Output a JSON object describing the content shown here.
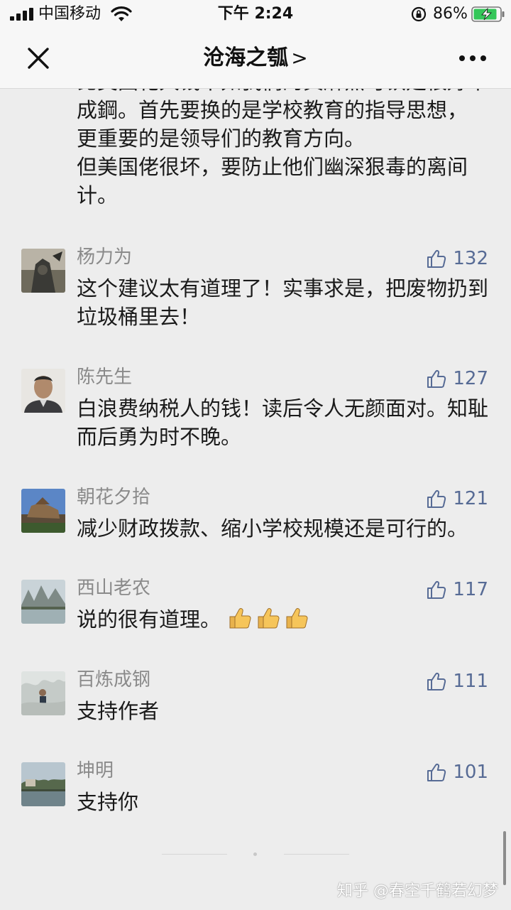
{
  "status_bar": {
    "carrier": "中国移动",
    "time": "下午 2:24",
    "battery_pct": "86%"
  },
  "nav": {
    "title": "沧海之瓠",
    "title_chevron": ">",
    "close_icon": "close-icon",
    "more_icon": "more-icon"
  },
  "article_tail": {
    "lines": [
      "成鋼。首先要换的是学校教育的指导思想，",
      "更重要的是领导们的教育方向。",
      "但美国佬很坏，要防止他们幽深狠毒的离间",
      "计。"
    ]
  },
  "comments": [
    {
      "name": "杨力为",
      "likes": "132",
      "text": "这个建议太有道理了！实事求是，把废物扔到垃圾桶里去！"
    },
    {
      "name": "陈先生",
      "likes": "127",
      "text": "白浪费纳税人的钱！读后令人无颜面对。知耻而后勇为时不晚。"
    },
    {
      "name": "朝花夕拾",
      "likes": "121",
      "text": "减少财政拨款、缩小学校规模还是可行的。"
    },
    {
      "name": "西山老农",
      "likes": "117",
      "text": "说的很有道理。",
      "emoji": [
        "thumbs-up-emoji",
        "thumbs-up-emoji",
        "thumbs-up-emoji"
      ]
    },
    {
      "name": "百炼成钢",
      "likes": "111",
      "text": "支持作者"
    },
    {
      "name": "坤明",
      "likes": "101",
      "text": "支持你"
    }
  ],
  "watermark": "知乎 @春空千鹤若幻梦",
  "colors": {
    "background": "#ededed",
    "link_blue": "#576b95",
    "name_gray": "#8a8a8a",
    "battery_green": "#34c759"
  }
}
